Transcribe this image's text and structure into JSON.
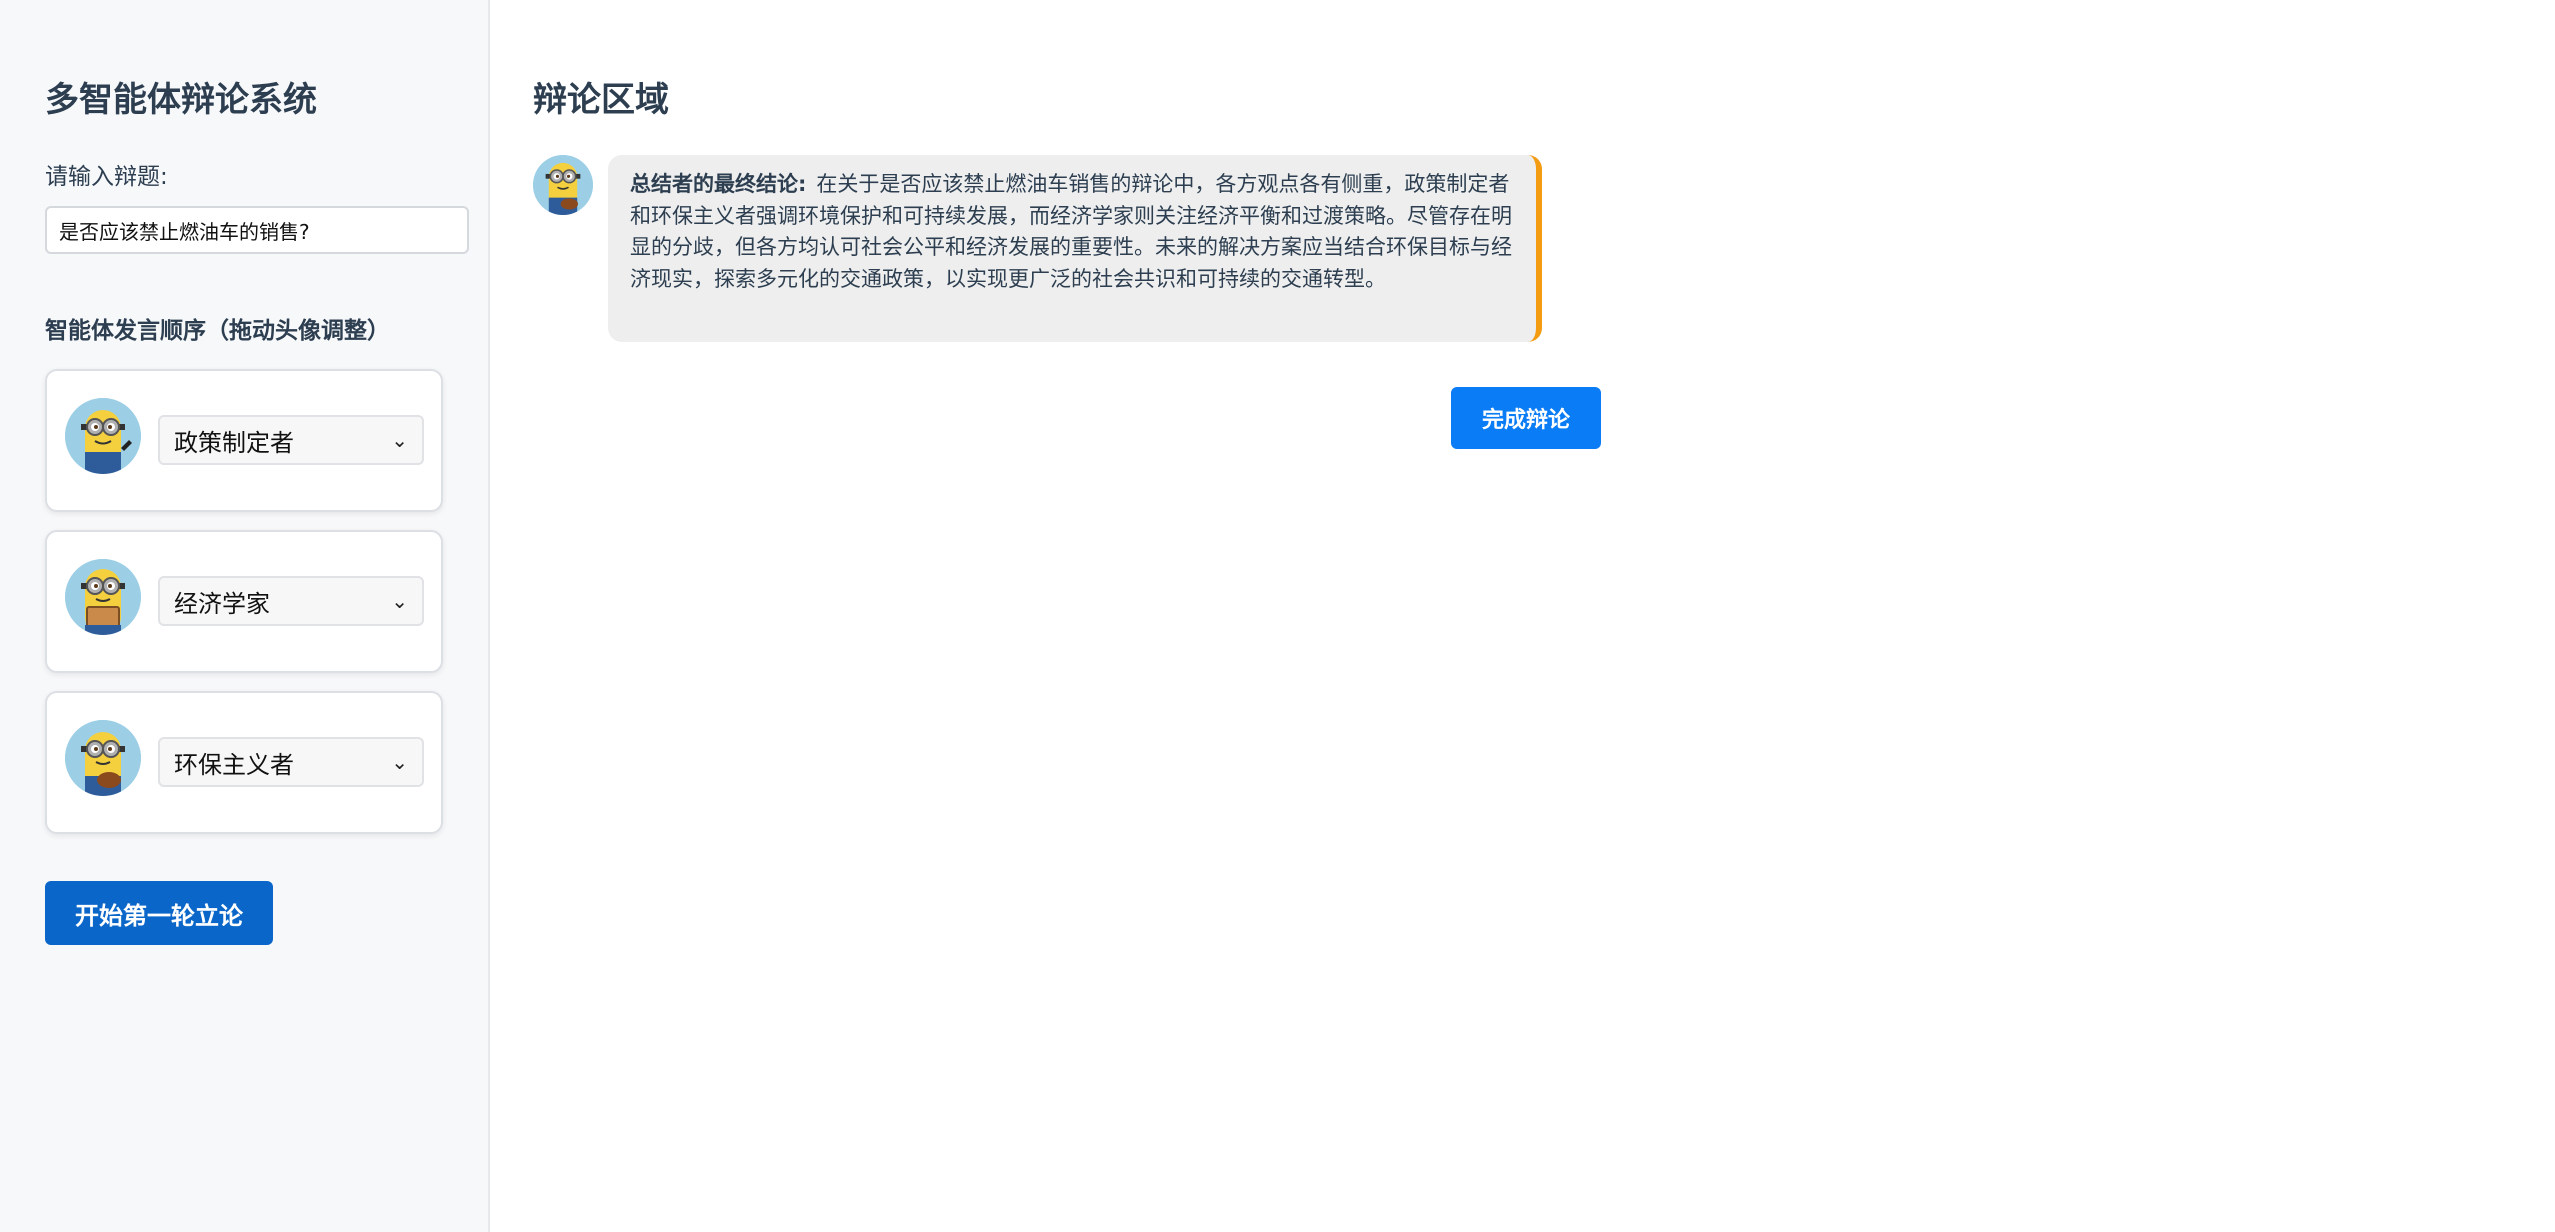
{
  "sidebar": {
    "title": "多智能体辩论系统",
    "topic_label": "请输入辩题:",
    "topic_value": "是否应该禁止燃油车的销售?",
    "order_label": "智能体发言顺序（拖动头像调整）",
    "agents": [
      {
        "role": "政策制定者",
        "avatar_icon": "minion-avatar-icon"
      },
      {
        "role": "经济学家",
        "avatar_icon": "minion-avatar-icon"
      },
      {
        "role": "环保主义者",
        "avatar_icon": "minion-avatar-icon"
      }
    ],
    "start_button": "开始第一轮立论"
  },
  "main": {
    "title": "辩论区域",
    "messages": [
      {
        "speaker": "总结者的最终结论:",
        "text": "在关于是否应该禁止燃油车销售的辩论中，各方观点各有侧重，政策制定者和环保主义者强调环境保护和可持续发展，而经济学家则关注经济平衡和过渡策略。尽管存在明显的分歧，但各方均认可社会公平和经济发展的重要性。未来的解决方案应当结合环保目标与经济现实，探索多元化的交通政策，以实现更广泛的社会共识和可持续的交通转型。",
        "accent_color": "#f39c12"
      }
    ],
    "finish_button": "完成辩论"
  },
  "colors": {
    "primary_button": "#0a66c8",
    "finish_button": "#0a7cf5",
    "sidebar_bg": "#f7f8fa",
    "bubble_bg": "#eeeeee",
    "bubble_accent": "#f39c12"
  }
}
